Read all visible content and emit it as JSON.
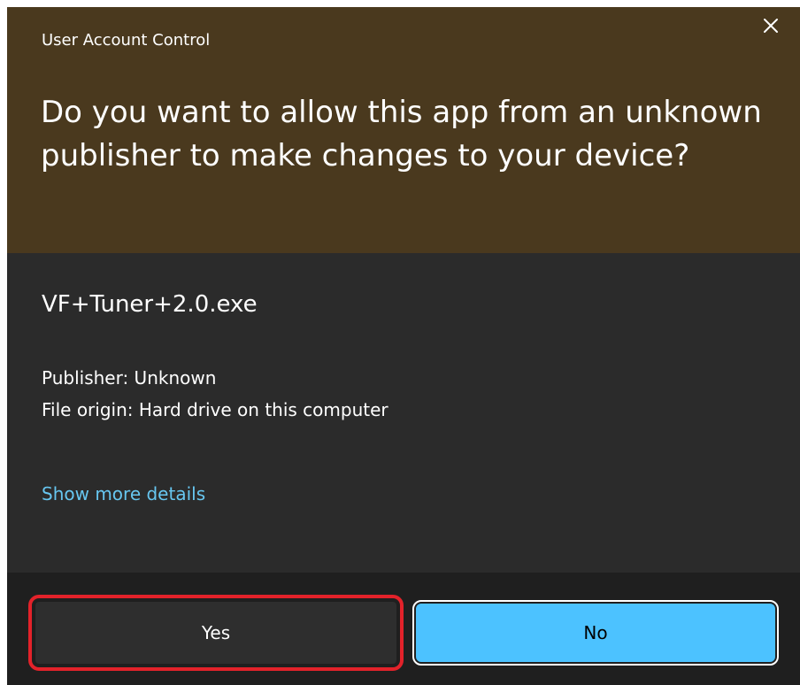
{
  "dialog": {
    "title": "User Account Control",
    "close_icon": "close-icon",
    "question": "Do you want to allow this app from an unknown publisher to make changes to your device?",
    "app_name": "VF+Tuner+2.0.exe",
    "publisher": "Publisher: Unknown",
    "file_origin": "File origin: Hard drive on this computer",
    "details_link": "Show more details"
  },
  "buttons": {
    "yes_label": "Yes",
    "no_label": "No"
  },
  "colors": {
    "header_bg": "#4a391e",
    "body_bg": "#2b2b2b",
    "footer_bg": "#1f1f1f",
    "link": "#67c6f0",
    "primary_button": "#4cc2ff",
    "highlight_box": "#e3222a"
  }
}
